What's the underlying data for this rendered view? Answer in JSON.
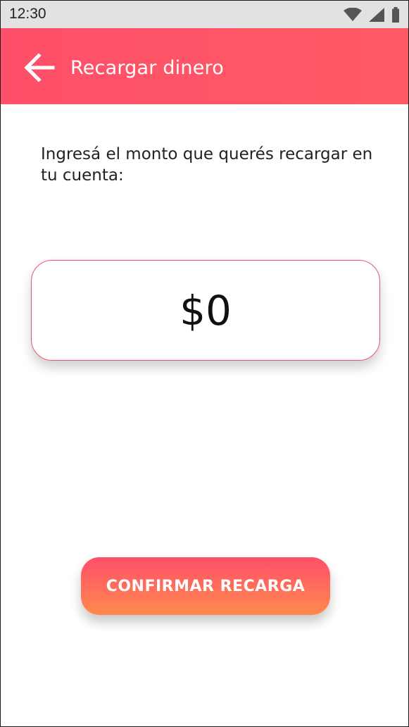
{
  "status_bar": {
    "time": "12:30",
    "icons": [
      "wifi-icon",
      "signal-icon",
      "battery-icon"
    ]
  },
  "app_bar": {
    "title": "Recargar dinero",
    "back_icon": "arrow-left-icon",
    "color": "#ff4f6b"
  },
  "content": {
    "instruction": "Ingresá el monto que querés recargar en tu cuenta:",
    "amount_value": "$0"
  },
  "confirm": {
    "label": "CONFIRMAR RECARGA",
    "gradient_top": "#ff4f6a",
    "gradient_bottom": "#ff8a4c"
  }
}
